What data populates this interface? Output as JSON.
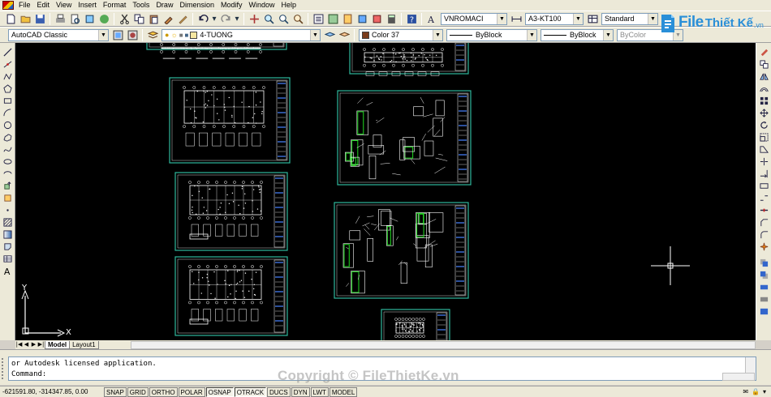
{
  "menu": [
    "File",
    "Edit",
    "View",
    "Insert",
    "Format",
    "Tools",
    "Draw",
    "Dimension",
    "Modify",
    "Window",
    "Help"
  ],
  "toolbar": {
    "text_style": "VNROMACI",
    "dim_style": "A3-KT100",
    "table_style": "Standard",
    "workspace": "AutoCAD Classic",
    "layer": "4-TUONG",
    "color": "Color 37",
    "linetype": "ByBlock",
    "lineweight": "ByBlock",
    "plotstyle": "ByColor"
  },
  "colors": {
    "layer_swatch": "#f5e6a0",
    "color_swatch": "#7a3b1a",
    "sheet_border": "#2fb89c",
    "drawing_white": "#ffffff",
    "drawing_green": "#22dd22",
    "title_blue": "#3a6bd0"
  },
  "logo": {
    "file": "File",
    "name": "Thiết Kế",
    "domain": ".vn"
  },
  "axes": {
    "y": "Y",
    "x": "X"
  },
  "tabs": [
    "Model",
    "Layout1"
  ],
  "command": {
    "history": "or Autodesk licensed application.",
    "prompt": "Command:"
  },
  "watermark": "Copyright © FileThietKe.vn",
  "status": {
    "coords": "-621591.80, -314347.85, 0.00",
    "toggles": [
      "SNAP",
      "GRID",
      "ORTHO",
      "POLAR",
      "OSNAP",
      "OTRACK",
      "DUCS",
      "DYN",
      "LWT",
      "MODEL"
    ]
  }
}
